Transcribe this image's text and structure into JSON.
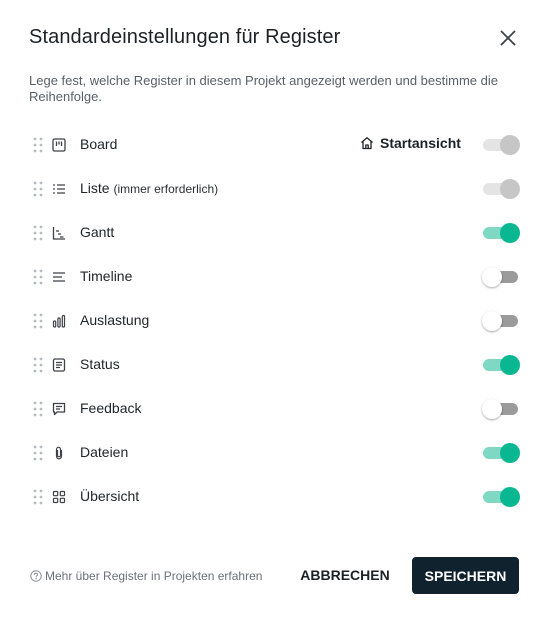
{
  "dialog": {
    "title": "Standardeinstellungen für Register",
    "description": "Lege fest, welche Register in diesem Projekt angezeigt werden und bestimme die Reihenfolge."
  },
  "tabs": [
    {
      "label": "Board",
      "icon": "board-icon",
      "state": "disabled-on",
      "start_view_label": "Startansicht"
    },
    {
      "label": "Liste",
      "note": "(immer erforderlich)",
      "icon": "list-icon",
      "state": "disabled-on"
    },
    {
      "label": "Gantt",
      "icon": "gantt-icon",
      "state": "on"
    },
    {
      "label": "Timeline",
      "icon": "timeline-icon",
      "state": "off"
    },
    {
      "label": "Auslastung",
      "icon": "workload-chart-icon",
      "state": "off"
    },
    {
      "label": "Status",
      "icon": "status-icon",
      "state": "on"
    },
    {
      "label": "Feedback",
      "icon": "feedback-icon",
      "state": "off"
    },
    {
      "label": "Dateien",
      "icon": "paperclip-icon",
      "state": "on"
    },
    {
      "label": "Übersicht",
      "icon": "overview-grid-icon",
      "state": "on"
    }
  ],
  "footer": {
    "help_link": "Mehr über Register in Projekten erfahren",
    "cancel_label": "ABBRECHEN",
    "save_label": "SPEICHERN"
  },
  "colors": {
    "toggle_on": "#09b890",
    "toggle_on_track": "#7fd8c4",
    "toggle_off_track": "#9b9b9b",
    "save_button_bg": "#11222f"
  }
}
